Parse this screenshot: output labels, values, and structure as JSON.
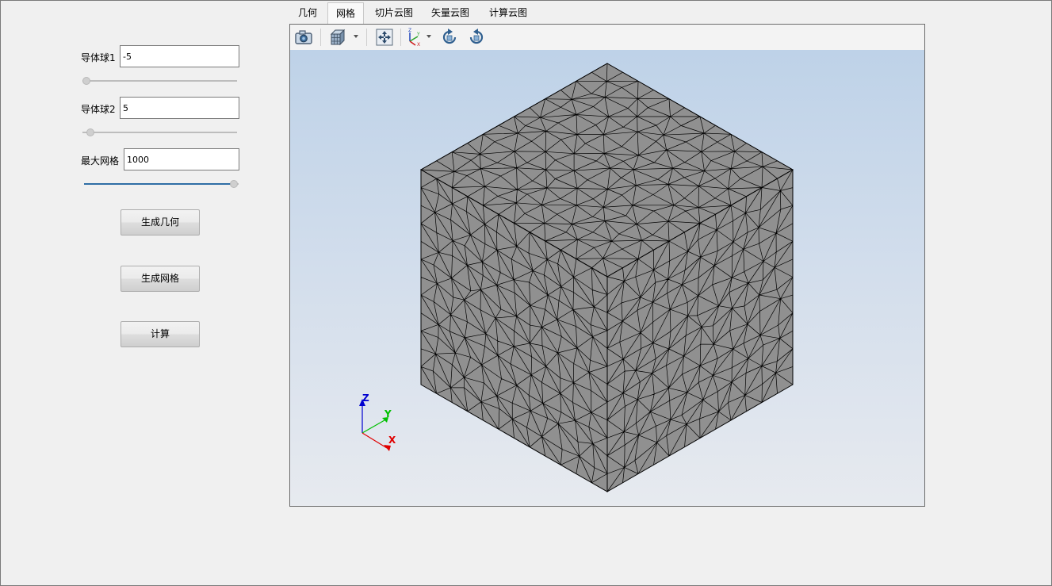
{
  "left_panel": {
    "sphere1": {
      "label": "导体球1",
      "value": "-5",
      "slider_fraction": 0.0
    },
    "sphere2": {
      "label": "导体球2",
      "value": "5",
      "slider_fraction": 0.03
    },
    "max_mesh": {
      "label": "最大网格",
      "value": "1000",
      "slider_fraction": 1.0
    },
    "buttons": {
      "gen_geometry": "生成几何",
      "gen_mesh": "生成网格",
      "compute": "计算"
    }
  },
  "tabs": [
    {
      "label": "几何",
      "active": false
    },
    {
      "label": "网格",
      "active": true
    },
    {
      "label": "切片云图",
      "active": false
    },
    {
      "label": "矢量云图",
      "active": false
    },
    {
      "label": "计算云图",
      "active": false
    }
  ],
  "toolbar": {
    "icons": [
      "camera-icon",
      "view-cube-icon",
      "fit-view-icon",
      "axes-orientation-icon",
      "rotate-ccw-icon",
      "rotate-cw-icon"
    ]
  },
  "viewport": {
    "object": "meshed-cube",
    "mesh_color": "#909090",
    "edge_color": "#000000",
    "axis_labels": {
      "x": "X",
      "y": "Y",
      "z": "Z"
    },
    "axis_colors": {
      "x": "#e00000",
      "y": "#00c000",
      "z": "#0000d0"
    }
  }
}
